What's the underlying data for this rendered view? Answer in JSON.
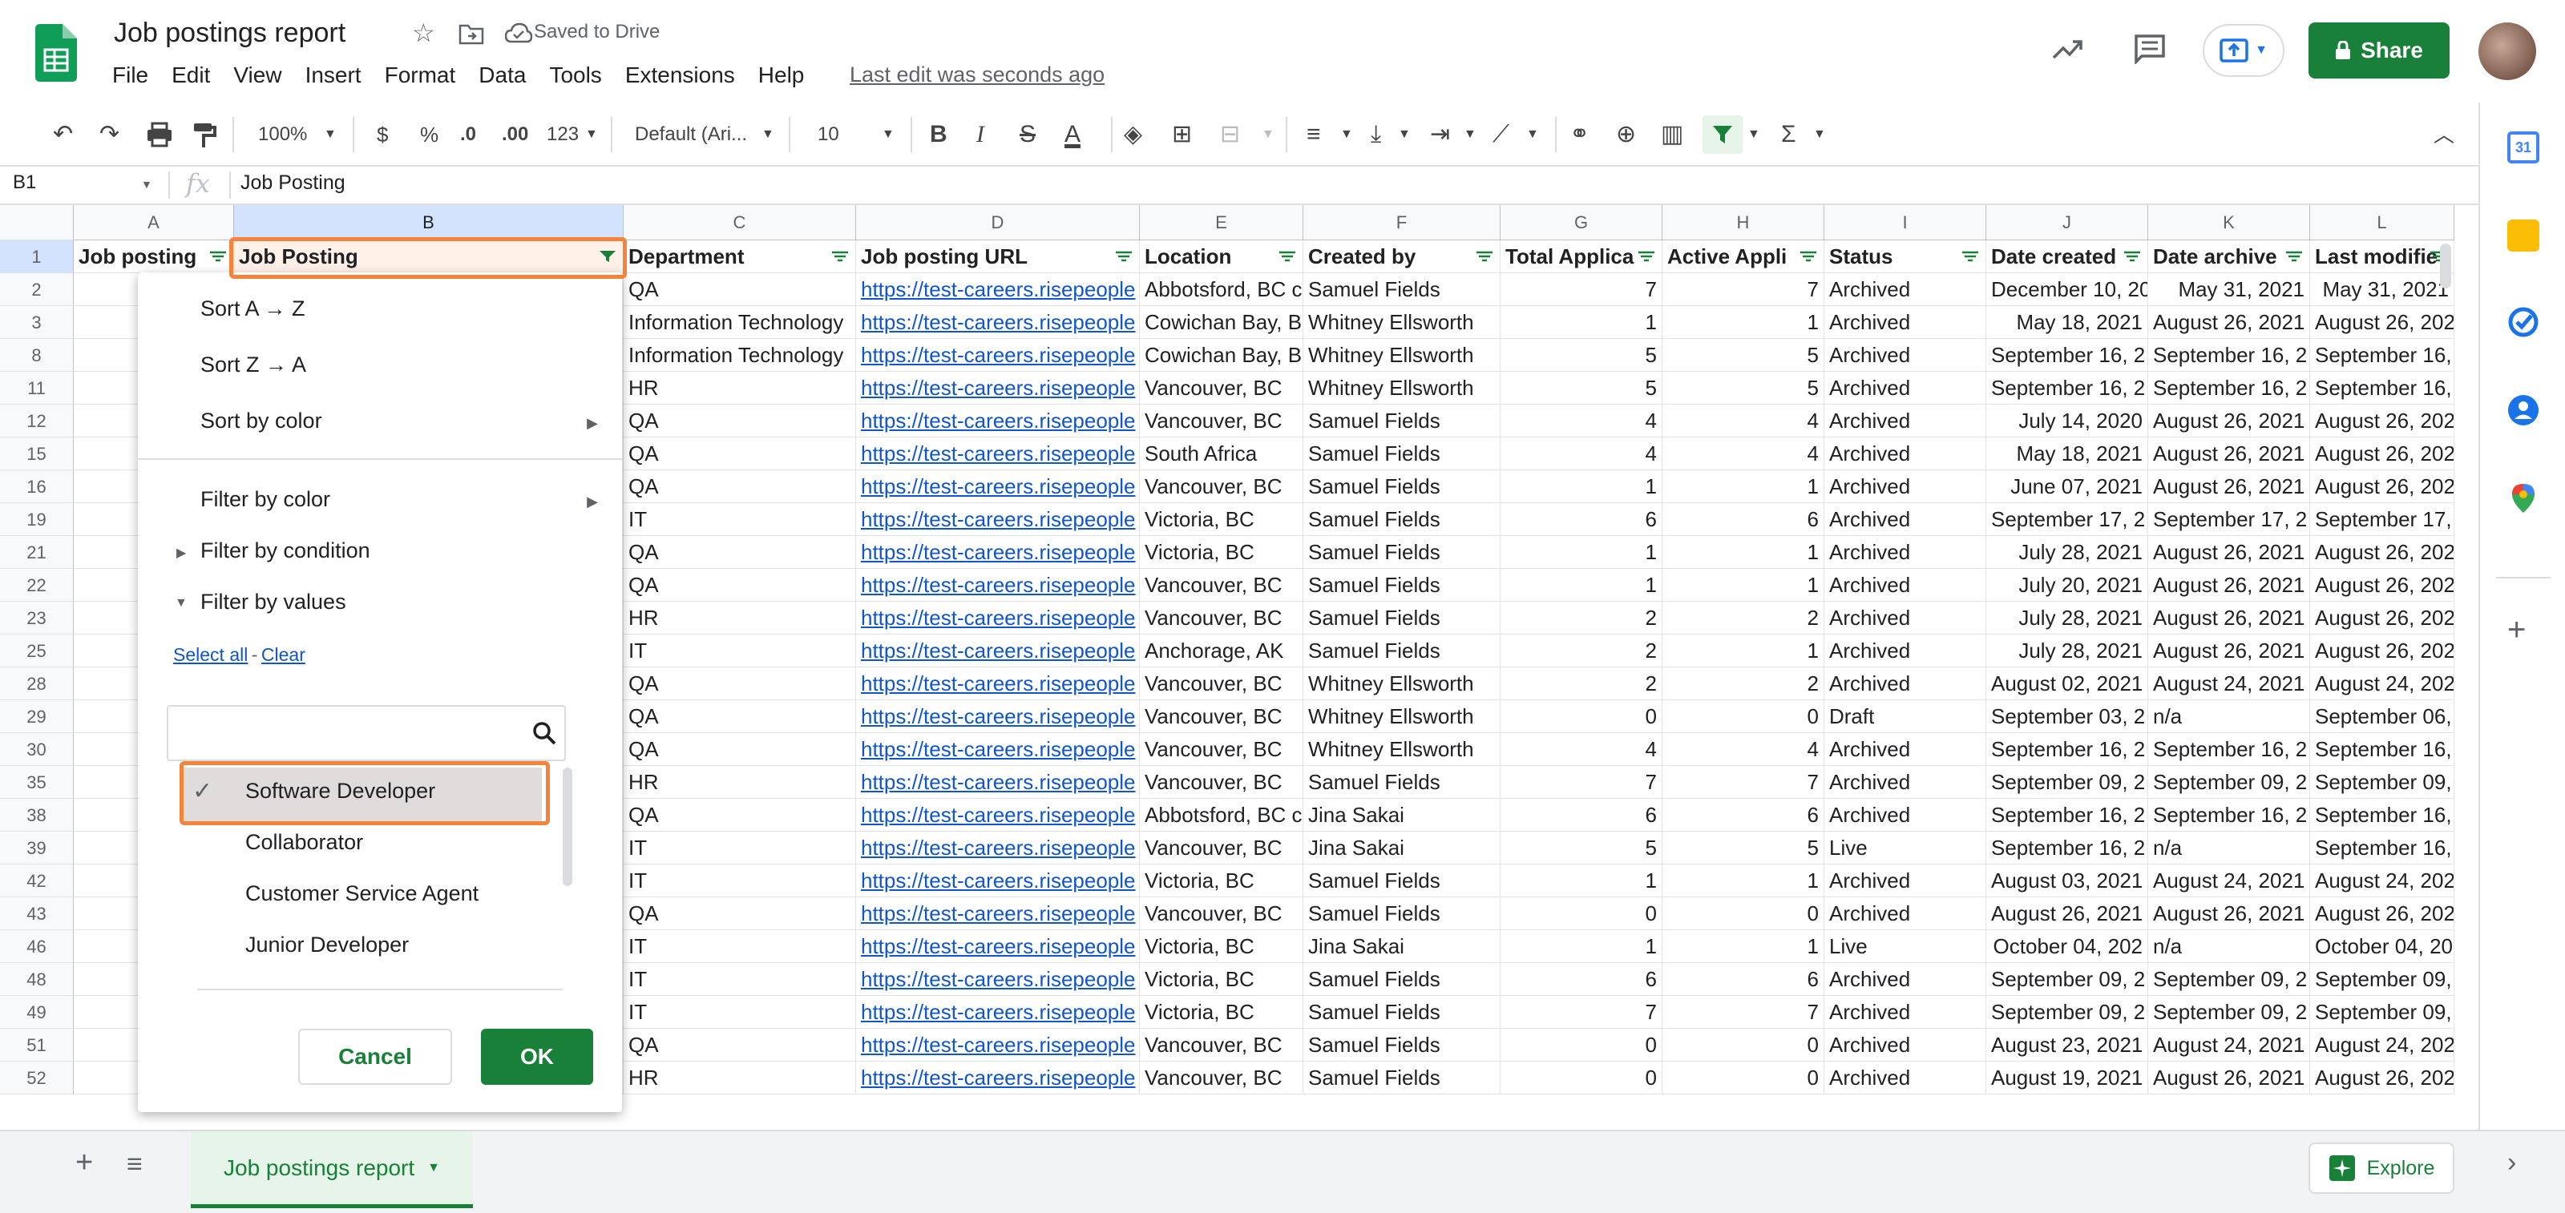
{
  "header": {
    "title": "Job postings report",
    "saved_status": "Saved to Drive",
    "last_edit": "Last edit was seconds ago",
    "share_label": "Share",
    "menu": [
      "File",
      "Edit",
      "View",
      "Insert",
      "Format",
      "Data",
      "Tools",
      "Extensions",
      "Help"
    ]
  },
  "toolbar": {
    "zoom": "100%",
    "currency": "$",
    "percent": "%",
    "dec_decrease": ".0",
    "dec_increase": ".00",
    "more_formats": "123",
    "font": "Default (Ari...",
    "font_size": "10",
    "bold": "B",
    "italic": "I",
    "strike": "S",
    "text_color": "A",
    "sum": "Σ"
  },
  "formula_bar": {
    "cell_ref": "B1",
    "fx": "fx",
    "content": "Job Posting"
  },
  "columns": [
    {
      "letter": "A"
    },
    {
      "letter": "B"
    },
    {
      "letter": "C"
    },
    {
      "letter": "D"
    },
    {
      "letter": "E"
    },
    {
      "letter": "F"
    },
    {
      "letter": "G"
    },
    {
      "letter": "H"
    },
    {
      "letter": "I"
    },
    {
      "letter": "J"
    },
    {
      "letter": "K"
    },
    {
      "letter": "L"
    }
  ],
  "header_row": {
    "row_num": "1",
    "cells": [
      "Job posting",
      "Job Posting",
      "Department",
      "Job posting URL",
      "Location",
      "Created by",
      "Total Applica",
      "Active Appli",
      "Status",
      "Date created",
      "Date archive",
      "Last modifie"
    ]
  },
  "rows": [
    {
      "n": "2",
      "c": "QA",
      "d": "https://test-careers.risepeople",
      "e": "Abbotsford, BC c",
      "f": "Samuel Fields",
      "g": "7",
      "h": "7",
      "i": "Archived",
      "j": "December 10, 20",
      "k": "May 31, 2021",
      "l": "May 31, 2021"
    },
    {
      "n": "3",
      "c": "Information Technology",
      "d": "https://test-careers.risepeople",
      "e": "Cowichan Bay, B",
      "f": "Whitney Ellsworth",
      "g": "1",
      "h": "1",
      "i": "Archived",
      "j": "May 18, 2021",
      "k": "August 26, 2021",
      "l": "August 26, 202"
    },
    {
      "n": "8",
      "c": "Information Technology",
      "d": "https://test-careers.risepeople",
      "e": "Cowichan Bay, B",
      "f": "Whitney Ellsworth",
      "g": "5",
      "h": "5",
      "i": "Archived",
      "j": "September 16, 2",
      "k": "September 16, 2",
      "l": "September 16,"
    },
    {
      "n": "11",
      "c": "HR",
      "d": "https://test-careers.risepeople",
      "e": "Vancouver, BC",
      "f": "Whitney Ellsworth",
      "g": "5",
      "h": "5",
      "i": "Archived",
      "j": "September 16, 2",
      "k": "September 16, 2",
      "l": "September 16,"
    },
    {
      "n": "12",
      "c": "QA",
      "d": "https://test-careers.risepeople",
      "e": "Vancouver, BC",
      "f": "Samuel Fields",
      "g": "4",
      "h": "4",
      "i": "Archived",
      "j": "July 14, 2020",
      "k": "August 26, 2021",
      "l": "August 26, 202"
    },
    {
      "n": "15",
      "c": "QA",
      "d": "https://test-careers.risepeople",
      "e": "South Africa",
      "f": "Samuel Fields",
      "g": "4",
      "h": "4",
      "i": "Archived",
      "j": "May 18, 2021",
      "k": "August 26, 2021",
      "l": "August 26, 202"
    },
    {
      "n": "16",
      "c": "QA",
      "d": "https://test-careers.risepeople",
      "e": "Vancouver, BC",
      "f": "Samuel Fields",
      "g": "1",
      "h": "1",
      "i": "Archived",
      "j": "June 07, 2021",
      "k": "August 26, 2021",
      "l": "August 26, 202"
    },
    {
      "n": "19",
      "c": "IT",
      "d": "https://test-careers.risepeople",
      "e": "Victoria, BC",
      "f": "Samuel Fields",
      "g": "6",
      "h": "6",
      "i": "Archived",
      "j": "September 17, 2",
      "k": "September 17, 2",
      "l": "September 17,"
    },
    {
      "n": "21",
      "c": "QA",
      "d": "https://test-careers.risepeople",
      "e": "Victoria, BC",
      "f": "Samuel Fields",
      "g": "1",
      "h": "1",
      "i": "Archived",
      "j": "July 28, 2021",
      "k": "August 26, 2021",
      "l": "August 26, 202"
    },
    {
      "n": "22",
      "c": "QA",
      "d": "https://test-careers.risepeople",
      "e": "Vancouver, BC",
      "f": "Samuel Fields",
      "g": "1",
      "h": "1",
      "i": "Archived",
      "j": "July 20, 2021",
      "k": "August 26, 2021",
      "l": "August 26, 202"
    },
    {
      "n": "23",
      "c": "HR",
      "d": "https://test-careers.risepeople",
      "e": "Vancouver, BC",
      "f": "Samuel Fields",
      "g": "2",
      "h": "2",
      "i": "Archived",
      "j": "July 28, 2021",
      "k": "August 26, 2021",
      "l": "August 26, 202"
    },
    {
      "n": "25",
      "c": "IT",
      "d": "https://test-careers.risepeople",
      "e": "Anchorage, AK",
      "f": "Samuel Fields",
      "g": "2",
      "h": "1",
      "i": "Archived",
      "j": "July 28, 2021",
      "k": "August 26, 2021",
      "l": "August 26, 202"
    },
    {
      "n": "28",
      "c": "QA",
      "d": "https://test-careers.risepeople",
      "e": "Vancouver, BC",
      "f": "Whitney Ellsworth",
      "g": "2",
      "h": "2",
      "i": "Archived",
      "j": "August 02, 2021",
      "k": "August 24, 2021",
      "l": "August 24, 202"
    },
    {
      "n": "29",
      "c": "QA",
      "d": "https://test-careers.risepeople",
      "e": "Vancouver, BC",
      "f": "Whitney Ellsworth",
      "g": "0",
      "h": "0",
      "i": "Draft",
      "j": "September 03, 2",
      "k": "n/a",
      "l": "September 06,"
    },
    {
      "n": "30",
      "c": "QA",
      "d": "https://test-careers.risepeople",
      "e": "Vancouver, BC",
      "f": "Whitney Ellsworth",
      "g": "4",
      "h": "4",
      "i": "Archived",
      "j": "September 16, 2",
      "k": "September 16, 2",
      "l": "September 16,"
    },
    {
      "n": "35",
      "c": "HR",
      "d": "https://test-careers.risepeople",
      "e": "Vancouver, BC",
      "f": "Samuel Fields",
      "g": "7",
      "h": "7",
      "i": "Archived",
      "j": "September 09, 2",
      "k": "September 09, 2",
      "l": "September 09,"
    },
    {
      "n": "38",
      "c": "QA",
      "d": "https://test-careers.risepeople",
      "e": "Abbotsford, BC c",
      "f": "Jina Sakai",
      "g": "6",
      "h": "6",
      "i": "Archived",
      "j": "September 16, 2",
      "k": "September 16, 2",
      "l": "September 16,"
    },
    {
      "n": "39",
      "c": "IT",
      "d": "https://test-careers.risepeople",
      "e": "Vancouver, BC",
      "f": "Jina Sakai",
      "g": "5",
      "h": "5",
      "i": "Live",
      "j": "September 16, 2",
      "k": "n/a",
      "l": "September 16,"
    },
    {
      "n": "42",
      "c": "IT",
      "d": "https://test-careers.risepeople",
      "e": "Victoria, BC",
      "f": "Samuel Fields",
      "g": "1",
      "h": "1",
      "i": "Archived",
      "j": "August 03, 2021",
      "k": "August 24, 2021",
      "l": "August 24, 202"
    },
    {
      "n": "43",
      "c": "QA",
      "d": "https://test-careers.risepeople",
      "e": "Vancouver, BC",
      "f": "Samuel Fields",
      "g": "0",
      "h": "0",
      "i": "Archived",
      "j": "August 26, 2021",
      "k": "August 26, 2021",
      "l": "August 26, 202"
    },
    {
      "n": "46",
      "c": "IT",
      "d": "https://test-careers.risepeople",
      "e": "Victoria, BC",
      "f": "Jina Sakai",
      "g": "1",
      "h": "1",
      "i": "Live",
      "j": "October 04, 202",
      "k": "n/a",
      "l": "October 04, 20"
    },
    {
      "n": "48",
      "c": "IT",
      "d": "https://test-careers.risepeople",
      "e": "Victoria, BC",
      "f": "Samuel Fields",
      "g": "6",
      "h": "6",
      "i": "Archived",
      "j": "September 09, 2",
      "k": "September 09, 2",
      "l": "September 09,"
    },
    {
      "n": "49",
      "c": "IT",
      "d": "https://test-careers.risepeople",
      "e": "Victoria, BC",
      "f": "Samuel Fields",
      "g": "7",
      "h": "7",
      "i": "Archived",
      "j": "September 09, 2",
      "k": "September 09, 2",
      "l": "September 09,"
    },
    {
      "n": "51",
      "c": "QA",
      "d": "https://test-careers.risepeople",
      "e": "Vancouver, BC",
      "f": "Samuel Fields",
      "g": "0",
      "h": "0",
      "i": "Archived",
      "j": "August 23, 2021",
      "k": "August 24, 2021",
      "l": "August 24, 202"
    },
    {
      "n": "52",
      "c": "HR",
      "d": "https://test-careers.risepeople",
      "e": "Vancouver, BC",
      "f": "Samuel Fields",
      "g": "0",
      "h": "0",
      "i": "Archived",
      "j": "August 19, 2021",
      "k": "August 26, 2021",
      "l": "August 26, 202"
    }
  ],
  "filter_menu": {
    "sort_az": "Sort A → Z",
    "sort_za": "Sort Z → A",
    "sort_color": "Sort by color",
    "filter_color": "Filter by color",
    "filter_condition": "Filter by condition",
    "filter_values": "Filter by values",
    "select_all": "Select all",
    "dash": "-",
    "clear": "Clear",
    "search_value": "",
    "values": [
      {
        "label": "Software Developer",
        "checked": true
      },
      {
        "label": "Collaborator",
        "checked": false
      },
      {
        "label": "Customer Service Agent",
        "checked": false
      },
      {
        "label": "Junior Developer",
        "checked": false
      }
    ],
    "cancel": "Cancel",
    "ok": "OK"
  },
  "bottom": {
    "sheet_tab": "Job postings report",
    "explore": "Explore"
  },
  "colors": {
    "green": "#188038",
    "highlight": "#f4843c",
    "link": "#1155cc",
    "selected_header": "#d3e3fd"
  }
}
